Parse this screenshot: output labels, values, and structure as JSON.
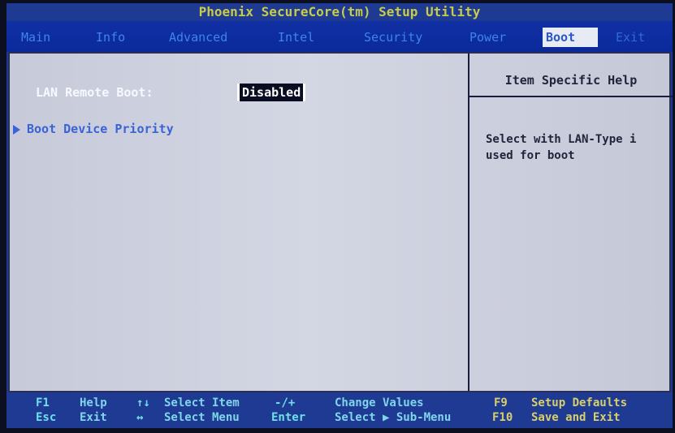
{
  "title": "Phoenix SecureCore(tm) Setup Utility",
  "menu": [
    {
      "label": "Main"
    },
    {
      "label": "Info"
    },
    {
      "label": "Advanced"
    },
    {
      "label": "Intel"
    },
    {
      "label": "Security"
    },
    {
      "label": "Power"
    },
    {
      "label": "Boot"
    },
    {
      "label": "Exit"
    }
  ],
  "active_menu": "Boot",
  "settings": {
    "lan_remote_boot": {
      "label": "LAN Remote Boot:",
      "value": "Disabled"
    },
    "boot_device_priority": {
      "label": "Boot Device Priority"
    }
  },
  "help": {
    "title": "Item Specific Help",
    "text": "Select with LAN-Type i\nused for boot"
  },
  "footer": {
    "row1": [
      {
        "key": "F1",
        "desc": "Help"
      },
      {
        "key": "↑↓",
        "desc": "Select Item"
      },
      {
        "key": "-/+",
        "desc": "Change Values"
      },
      {
        "key": "F9",
        "desc": "Setup Defaults"
      }
    ],
    "row2": [
      {
        "key": "Esc",
        "desc": "Exit"
      },
      {
        "key": "↔",
        "desc": "Select Menu"
      },
      {
        "key": "Enter",
        "desc": "Select ▶ Sub-Menu"
      },
      {
        "key": "F10",
        "desc": "Save and Exit"
      }
    ]
  },
  "colors": {
    "screen_bg": "#1f3a92",
    "content_bg": "#cfd2df",
    "title": "#c8cc4a",
    "menu_text": "#3d86e6",
    "active_tab_bg": "#e7ecf4",
    "selected_value_bg": "#0a0c22",
    "link": "#3a63d6",
    "footer_key": "#6fe0ea",
    "footer_yellow": "#d9cf6a"
  },
  "icons": {
    "submenu_arrow": "triangle-right-icon"
  }
}
